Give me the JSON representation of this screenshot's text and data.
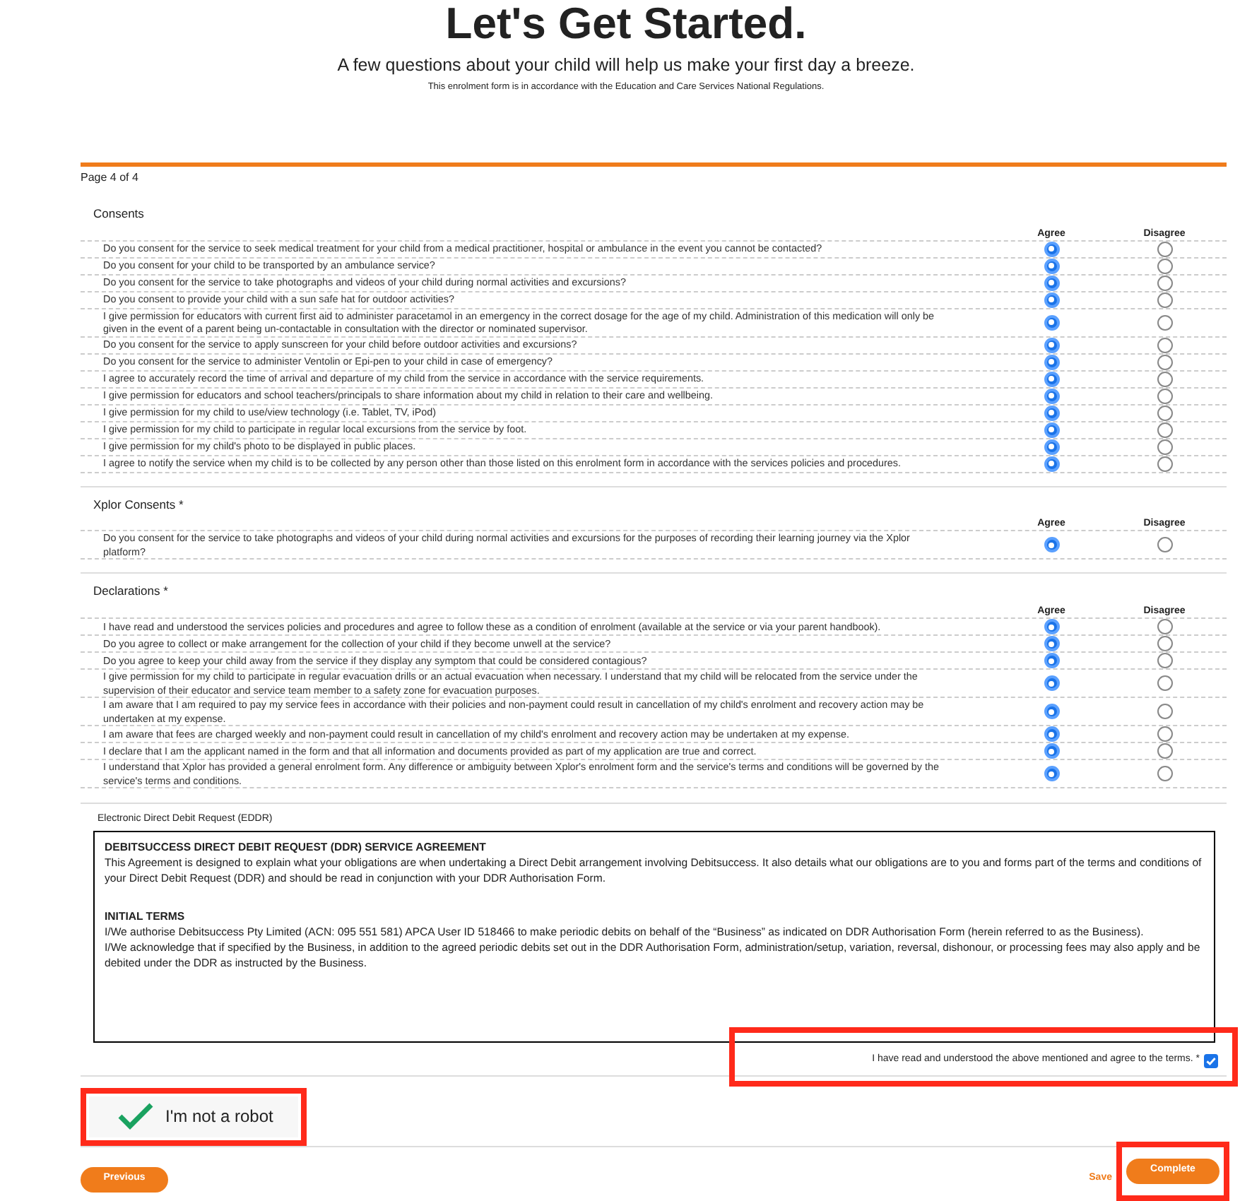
{
  "header": {
    "title": "Let's Get Started.",
    "subtitle": "A few questions about your child will help us make your first day a breeze.",
    "note": "This enrolment form is in accordance with the Education and Care Services National Regulations."
  },
  "page_indicator": "Page 4 of 4",
  "sections": [
    {
      "title": "Consents",
      "columns": [
        "Agree",
        "Disagree"
      ],
      "rows": [
        {
          "text": "Do you consent for the service to seek medical treatment for your child from a medical practitioner, hospital or ambulance in the event you cannot be contacted?",
          "agreed": true
        },
        {
          "text": "Do you consent for your child to be transported by an ambulance service?",
          "agreed": true
        },
        {
          "text": "Do you consent for the service to take photographs and videos of your child during normal activities and excursions?",
          "agreed": true
        },
        {
          "text": "Do you consent to provide your child with a sun safe hat for outdoor activities?",
          "agreed": true
        },
        {
          "text": "I give permission for educators with current first aid to administer paracetamol in an emergency in the correct dosage for the age of my child. Administration of this medication will only be given in the event of a parent being un-contactable in consultation with the director or nominated supervisor.",
          "agreed": true
        },
        {
          "text": "Do you consent for the service to apply sunscreen for your child before outdoor activities and excursions?",
          "agreed": true
        },
        {
          "text": "Do you consent for the service to administer Ventolin or Epi-pen to your child in case of emergency?",
          "agreed": true
        },
        {
          "text": "I agree to accurately record the time of arrival and departure of my child from the service in accordance with the service requirements.",
          "agreed": true
        },
        {
          "text": "I give permission for educators and school teachers/principals to share information about my child in relation to their care and wellbeing.",
          "agreed": true
        },
        {
          "text": "I give permission for my child to use/view technology (i.e. Tablet, TV, iPod)",
          "agreed": true
        },
        {
          "text": "I give permission for my child to participate in regular local excursions from the service by foot.",
          "agreed": true
        },
        {
          "text": "I give permission for my child's photo to be displayed in public places.",
          "agreed": true
        },
        {
          "text": "I agree to notify the service when my child is to be collected by any person other than those listed on this enrolment form in accordance with the services policies and procedures.",
          "agreed": true
        }
      ]
    },
    {
      "title": "Xplor Consents *",
      "columns": [
        "Agree",
        "Disagree"
      ],
      "rows": [
        {
          "text": "Do you consent for the service to take photographs and videos of your child during normal activities and excursions for the purposes of recording their learning journey via the Xplor platform?",
          "agreed": true
        }
      ]
    },
    {
      "title": "Declarations *",
      "columns": [
        "Agree",
        "Disagree"
      ],
      "rows": [
        {
          "text": "I have read and understood the services policies and procedures and agree to follow these as a condition of enrolment (available at the service or via your parent handbook).",
          "agreed": true
        },
        {
          "text": "Do you agree to collect or make arrangement for the collection of your child if they become unwell at the service?",
          "agreed": true
        },
        {
          "text": "Do you agree to keep your child away from the service if they display any symptom that could be considered contagious?",
          "agreed": true
        },
        {
          "text": "I give permission for my child to participate in regular evacuation drills or an actual evacuation when necessary. I understand that my child will be relocated from the service under the supervision of their educator and service team member to a safety zone for evacuation purposes.",
          "agreed": true
        },
        {
          "text": "I am aware that I am required to pay my service fees in accordance with their policies and non-payment could result in cancellation of my child's enrolment and recovery action may be undertaken at my expense.",
          "agreed": true
        },
        {
          "text": "I am aware that fees are charged weekly and non-payment could result in cancellation of my child's enrolment and recovery action may be undertaken at my expense.",
          "agreed": true
        },
        {
          "text": "I declare that I am the applicant named in the form and that all information and documents provided as part of my application are true and correct.",
          "agreed": true
        },
        {
          "text": "I understand that Xplor has provided a general enrolment form. Any difference or ambiguity between Xplor's enrolment form and the service's terms and conditions will be governed by the service's terms and conditions.",
          "agreed": true
        }
      ]
    }
  ],
  "eddr": {
    "label": "Electronic Direct Debit Request (EDDR)",
    "blocks": [
      {
        "heading": "DEBITSUCCESS DIRECT DEBIT REQUEST (DDR) SERVICE AGREEMENT",
        "paragraphs": [
          "This Agreement is designed to explain what your obligations are when undertaking a Direct Debit arrangement involving Debitsuccess.  It also details what our obligations are to you and forms part of the terms and conditions of your Direct Debit Request (DDR) and should be read in conjunction with your DDR Authorisation Form."
        ]
      },
      {
        "heading": "INITIAL TERMS",
        "paragraphs": [
          "I/We authorise Debitsuccess Pty Limited (ACN: 095 551 581) APCA User ID 518466 to make periodic debits on behalf of the “Business” as indicated on DDR Authorisation Form (herein referred to as the Business).",
          "I/We acknowledge that if specified by the Business, in addition to the agreed periodic debits set out in the DDR Authorisation Form, administration/setup, variation, reversal, dishonour,  or processing fees may also apply and be debited under the DDR as instructed by the Business."
        ]
      }
    ]
  },
  "terms_agreement": {
    "label": "I have read and understood the above mentioned and agree to the terms. *",
    "checked": true
  },
  "captcha": {
    "label": "I'm not a robot",
    "checked": true
  },
  "buttons": {
    "previous": "Previous",
    "save": "Save",
    "complete": "Complete"
  }
}
